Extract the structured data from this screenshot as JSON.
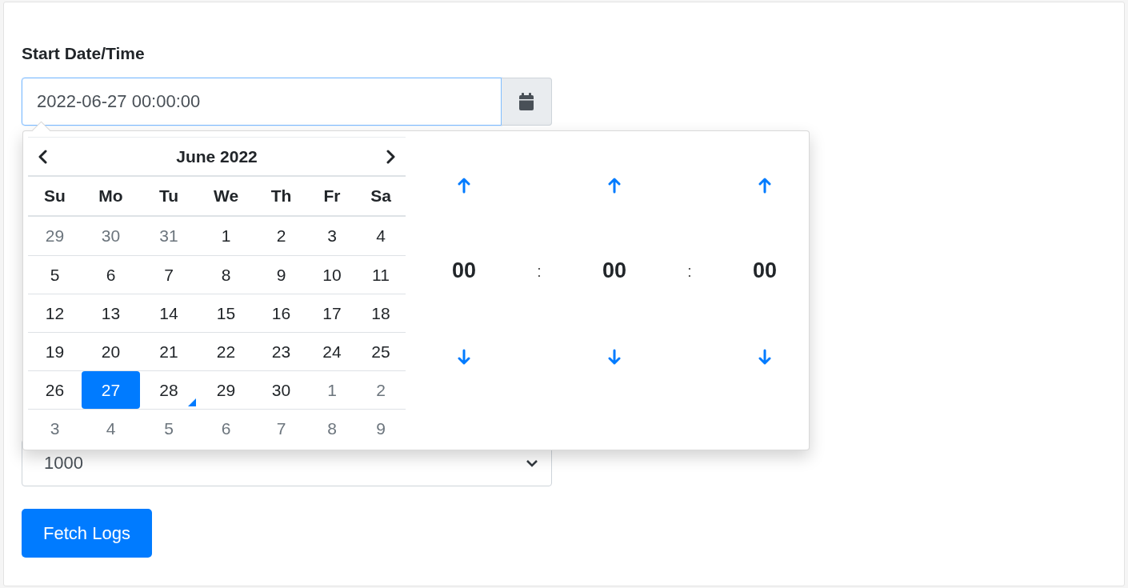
{
  "label": "Start Date/Time",
  "date_input": {
    "value": "2022-06-27 00:00:00"
  },
  "picker": {
    "month_title": "June 2022",
    "weekdays": [
      "Su",
      "Mo",
      "Tu",
      "We",
      "Th",
      "Fr",
      "Sa"
    ],
    "weeks": [
      [
        {
          "day": "29",
          "outside": true,
          "selected": false,
          "today": false
        },
        {
          "day": "30",
          "outside": true,
          "selected": false,
          "today": false
        },
        {
          "day": "31",
          "outside": true,
          "selected": false,
          "today": false
        },
        {
          "day": "1",
          "outside": false,
          "selected": false,
          "today": false
        },
        {
          "day": "2",
          "outside": false,
          "selected": false,
          "today": false
        },
        {
          "day": "3",
          "outside": false,
          "selected": false,
          "today": false
        },
        {
          "day": "4",
          "outside": false,
          "selected": false,
          "today": false
        }
      ],
      [
        {
          "day": "5",
          "outside": false,
          "selected": false,
          "today": false
        },
        {
          "day": "6",
          "outside": false,
          "selected": false,
          "today": false
        },
        {
          "day": "7",
          "outside": false,
          "selected": false,
          "today": false
        },
        {
          "day": "8",
          "outside": false,
          "selected": false,
          "today": false
        },
        {
          "day": "9",
          "outside": false,
          "selected": false,
          "today": false
        },
        {
          "day": "10",
          "outside": false,
          "selected": false,
          "today": false
        },
        {
          "day": "11",
          "outside": false,
          "selected": false,
          "today": false
        }
      ],
      [
        {
          "day": "12",
          "outside": false,
          "selected": false,
          "today": false
        },
        {
          "day": "13",
          "outside": false,
          "selected": false,
          "today": false
        },
        {
          "day": "14",
          "outside": false,
          "selected": false,
          "today": false
        },
        {
          "day": "15",
          "outside": false,
          "selected": false,
          "today": false
        },
        {
          "day": "16",
          "outside": false,
          "selected": false,
          "today": false
        },
        {
          "day": "17",
          "outside": false,
          "selected": false,
          "today": false
        },
        {
          "day": "18",
          "outside": false,
          "selected": false,
          "today": false
        }
      ],
      [
        {
          "day": "19",
          "outside": false,
          "selected": false,
          "today": false
        },
        {
          "day": "20",
          "outside": false,
          "selected": false,
          "today": false
        },
        {
          "day": "21",
          "outside": false,
          "selected": false,
          "today": false
        },
        {
          "day": "22",
          "outside": false,
          "selected": false,
          "today": false
        },
        {
          "day": "23",
          "outside": false,
          "selected": false,
          "today": false
        },
        {
          "day": "24",
          "outside": false,
          "selected": false,
          "today": false
        },
        {
          "day": "25",
          "outside": false,
          "selected": false,
          "today": false
        }
      ],
      [
        {
          "day": "26",
          "outside": false,
          "selected": false,
          "today": false
        },
        {
          "day": "27",
          "outside": false,
          "selected": true,
          "today": false
        },
        {
          "day": "28",
          "outside": false,
          "selected": false,
          "today": true
        },
        {
          "day": "29",
          "outside": false,
          "selected": false,
          "today": false
        },
        {
          "day": "30",
          "outside": false,
          "selected": false,
          "today": false
        },
        {
          "day": "1",
          "outside": true,
          "selected": false,
          "today": false
        },
        {
          "day": "2",
          "outside": true,
          "selected": false,
          "today": false
        }
      ],
      [
        {
          "day": "3",
          "outside": true,
          "selected": false,
          "today": false
        },
        {
          "day": "4",
          "outside": true,
          "selected": false,
          "today": false
        },
        {
          "day": "5",
          "outside": true,
          "selected": false,
          "today": false
        },
        {
          "day": "6",
          "outside": true,
          "selected": false,
          "today": false
        },
        {
          "day": "7",
          "outside": true,
          "selected": false,
          "today": false
        },
        {
          "day": "8",
          "outside": true,
          "selected": false,
          "today": false
        },
        {
          "day": "9",
          "outside": true,
          "selected": false,
          "today": false
        }
      ]
    ],
    "time": [
      {
        "kind": "unit",
        "value": "00"
      },
      {
        "kind": "separator",
        "value": ":"
      },
      {
        "kind": "unit",
        "value": "00"
      },
      {
        "kind": "separator",
        "value": ":"
      },
      {
        "kind": "unit",
        "value": "00"
      }
    ]
  },
  "limit_select": {
    "value": "1000"
  },
  "submit_button": "Fetch Logs"
}
